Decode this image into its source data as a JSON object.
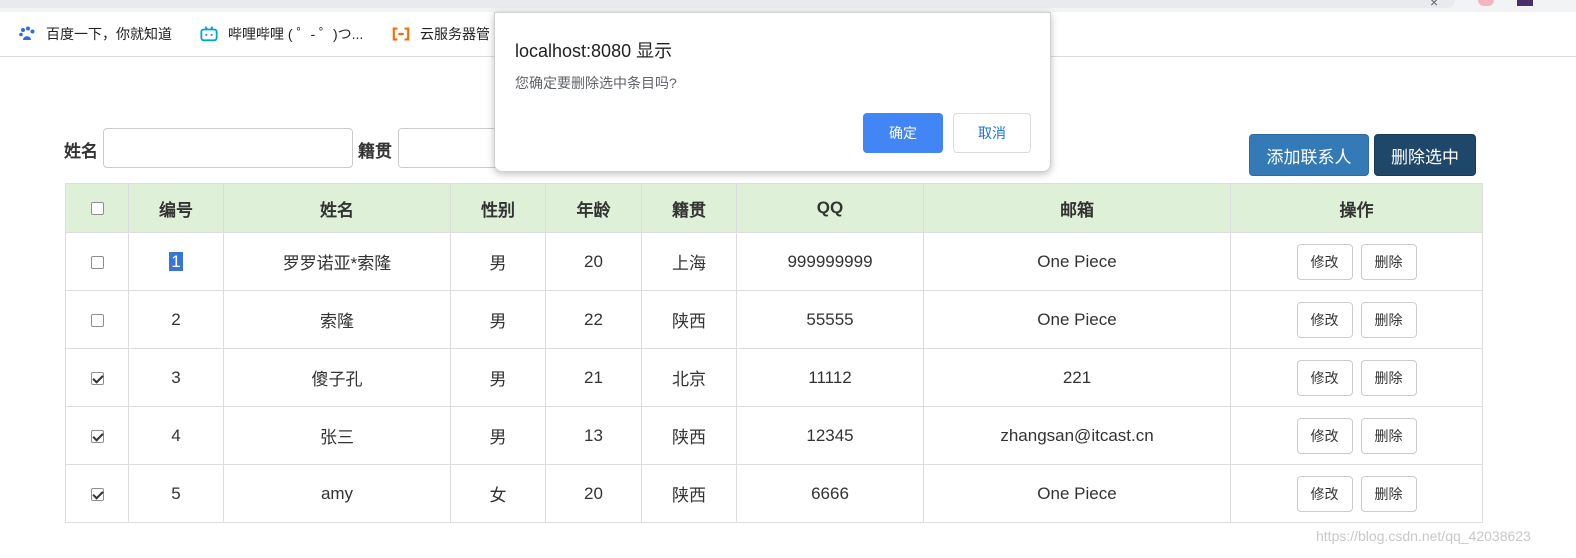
{
  "bookmarks": [
    {
      "label": "百度一下，你就知道",
      "icon": "baidu-paw-icon"
    },
    {
      "label": "哔哩哔哩 ( ゜- ゜)つ...",
      "icon": "bilibili-tv-icon"
    },
    {
      "label": "云服务器管",
      "icon": "aliyun-bracket-icon"
    }
  ],
  "search": {
    "name_label": "姓名",
    "name_value": "",
    "origin_label": "籍贯",
    "origin_value": ""
  },
  "toolbar": {
    "add_label": "添加联系人",
    "delete_selected_label": "删除选中",
    "add_color": "#337ab7",
    "delete_color": "#1e4769"
  },
  "table": {
    "headers": [
      "编号",
      "姓名",
      "性别",
      "年龄",
      "籍贯",
      "QQ",
      "邮箱",
      "操作"
    ],
    "edit_label": "修改",
    "delete_label": "删除",
    "header_bg": "#dff0d8",
    "rows": [
      {
        "checked": false,
        "id": "1",
        "name": "罗罗诺亚*索隆",
        "gender": "男",
        "age": "20",
        "origin": "上海",
        "qq": "999999999",
        "email": "One Piece"
      },
      {
        "checked": false,
        "id": "2",
        "name": "索隆",
        "gender": "男",
        "age": "22",
        "origin": "陕西",
        "qq": "55555",
        "email": "One Piece"
      },
      {
        "checked": true,
        "id": "3",
        "name": "傻子孔",
        "gender": "男",
        "age": "21",
        "origin": "北京",
        "qq": "11112",
        "email": "221"
      },
      {
        "checked": true,
        "id": "4",
        "name": "张三",
        "gender": "男",
        "age": "13",
        "origin": "陕西",
        "qq": "12345",
        "email": "zhangsan@itcast.cn"
      },
      {
        "checked": true,
        "id": "5",
        "name": "amy",
        "gender": "女",
        "age": "20",
        "origin": "陕西",
        "qq": "6666",
        "email": "One Piece"
      }
    ]
  },
  "dialog": {
    "title": "localhost:8080 显示",
    "message": "您确定要删除选中条目吗?",
    "ok_label": "确定",
    "cancel_label": "取消",
    "ok_color": "#4285f4"
  },
  "watermark": "https://blog.csdn.net/qq_42038623"
}
